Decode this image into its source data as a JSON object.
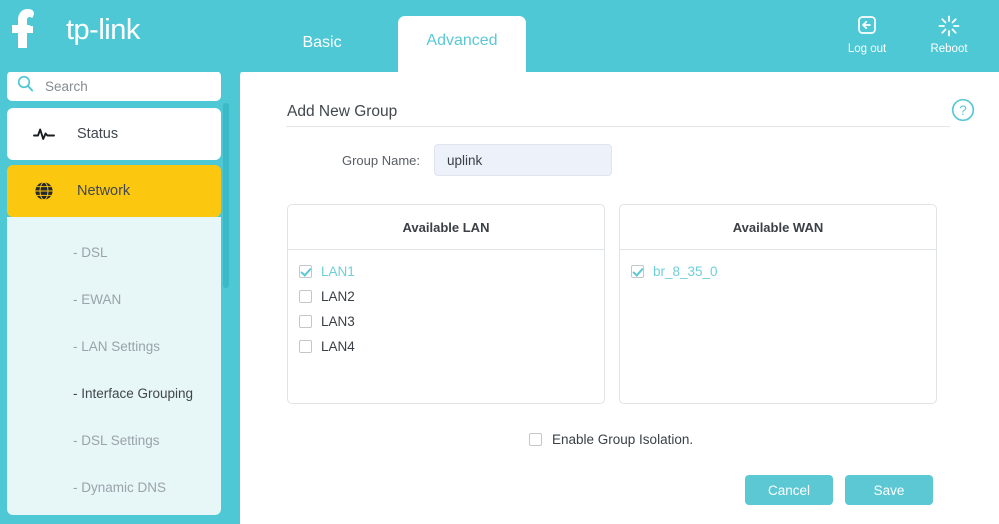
{
  "brand": {
    "name": "tp-link",
    "logo_icon": "tp-link-logo-icon"
  },
  "topbar": {
    "tabs": [
      {
        "label": "Basic",
        "active": false
      },
      {
        "label": "Advanced",
        "active": true
      }
    ],
    "actions": [
      {
        "label": "Log out",
        "icon": "logout-icon"
      },
      {
        "label": "Reboot",
        "icon": "reboot-icon"
      }
    ]
  },
  "sidebar": {
    "search": {
      "placeholder": "Search",
      "value": "",
      "icon": "search-icon"
    },
    "items": [
      {
        "label": "Status",
        "icon": "pulse-icon",
        "state": "white"
      },
      {
        "label": "Network",
        "icon": "globe-icon",
        "state": "active"
      }
    ],
    "subitems": [
      {
        "label": "- DSL",
        "selected": false
      },
      {
        "label": "- EWAN",
        "selected": false
      },
      {
        "label": "- LAN Settings",
        "selected": false
      },
      {
        "label": "- Interface Grouping",
        "selected": true
      },
      {
        "label": "- DSL Settings",
        "selected": false
      },
      {
        "label": "- Dynamic DNS",
        "selected": false
      }
    ]
  },
  "main": {
    "title": "Add New Group",
    "help_icon": "help-circle-icon",
    "group_name": {
      "label": "Group Name:",
      "value": "uplink",
      "placeholder": ""
    },
    "lan_box": {
      "header": "Available LAN",
      "options": [
        {
          "label": "LAN1",
          "checked": true
        },
        {
          "label": "LAN2",
          "checked": false
        },
        {
          "label": "LAN3",
          "checked": false
        },
        {
          "label": "LAN4",
          "checked": false
        }
      ]
    },
    "wan_box": {
      "header": "Available WAN",
      "options": [
        {
          "label": "br_8_35_0",
          "checked": true
        }
      ]
    },
    "isolation": {
      "label": "Enable Group Isolation.",
      "checked": false
    },
    "buttons": {
      "cancel": "Cancel",
      "save": "Save"
    }
  },
  "colors": {
    "brand_teal": "#4ec8d4",
    "accent_teal": "#5bc8d4",
    "highlight_yellow": "#fcc80f",
    "subnav_bg": "#e7f6f7",
    "input_bg": "#edf1f9"
  }
}
